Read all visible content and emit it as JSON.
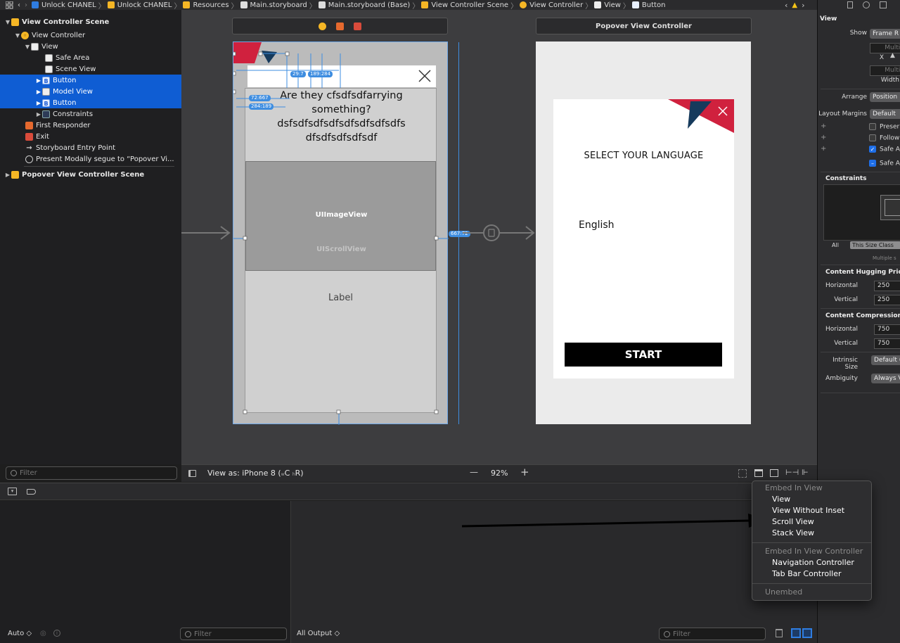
{
  "jumpbar": {
    "segments": [
      "Unlock CHANEL",
      "Unlock CHANEL",
      "Resources",
      "Main.storyboard",
      "Main.storyboard (Base)",
      "View Controller Scene",
      "View Controller",
      "View",
      "Button"
    ]
  },
  "outline": {
    "items": [
      {
        "label": "View Controller Scene"
      },
      {
        "label": "View Controller"
      },
      {
        "label": "View"
      },
      {
        "label": "Safe Area"
      },
      {
        "label": "Scene View"
      },
      {
        "label": "Button"
      },
      {
        "label": "Model View"
      },
      {
        "label": "Button"
      },
      {
        "label": "Constraints"
      },
      {
        "label": "First Responder"
      },
      {
        "label": "Exit"
      },
      {
        "label": "Storyboard Entry Point"
      },
      {
        "label": "Present Modally segue to “Popover Vi..."
      },
      {
        "label": "Popover View Controller Scene"
      }
    ],
    "filter_placeholder": "Filter"
  },
  "canvas": {
    "vc1": {
      "question": "Are they cfsdfsdfarrying something? dsfsdfsdfsdfsdfsdfsdfsdfs dfsdfsdfsdfsdf",
      "image_view_label": "UIImageView",
      "scroll_view_label": "UIScrollView",
      "label_text": "Label",
      "badges": [
        "29:7",
        "189:284",
        "72:667",
        "284:189",
        "667:72"
      ]
    },
    "vc2": {
      "header": "Popover View Controller",
      "title": "SELECT YOUR LANGUAGE",
      "language": "English",
      "start_button": "START"
    }
  },
  "canvasbar": {
    "view_as": "View as: iPhone 8 (",
    "view_as_c": "C",
    "view_as_r": "R)",
    "zoom": "92%",
    "minus": "—",
    "plus": "+"
  },
  "debug": {
    "auto": "Auto",
    "output": "All Output",
    "filter1": "Filter",
    "filter2": "Filter"
  },
  "inspector": {
    "section": "View",
    "show_label": "Show",
    "show_value": "Frame R",
    "multiple1": "Multip",
    "x_label": "X",
    "multiple2": "Multip",
    "width_label": "Width",
    "arrange_label": "Arrange",
    "arrange_value": "Position",
    "layout_margins_label": "Layout Margins",
    "layout_margins_value": "Default",
    "preserve": "Preser",
    "follow": "Follow",
    "safe_area1": "Safe A",
    "safe_area2": "Safe A",
    "constraints_title": "Constraints",
    "seg_all": "All",
    "seg_size_class": "This Size Class",
    "multiple_sel": "Multiple s",
    "hugging_title": "Content Hugging Priority",
    "horizontal": "Horizontal",
    "vertical": "Vertical",
    "hug_h": "250",
    "hug_v": "250",
    "compression_title": "Content Compression Re",
    "comp_h": "750",
    "comp_v": "750",
    "intrinsic_label": "Intrinsic Size",
    "intrinsic_value": "Default (",
    "ambiguity_label": "Ambiguity",
    "ambiguity_value": "Always V"
  },
  "menu": {
    "header1": "Embed In View",
    "items1": [
      "View",
      "View Without Inset",
      "Scroll View",
      "Stack View"
    ],
    "header2": "Embed In View Controller",
    "items2": [
      "Navigation Controller",
      "Tab Bar Controller"
    ],
    "header3": "Unembed"
  },
  "colors": {
    "selection": "#0f5dd3",
    "accent_red": "#d0213e",
    "accent_navy": "#163a5c",
    "constraint_blue": "#3e8de0"
  }
}
